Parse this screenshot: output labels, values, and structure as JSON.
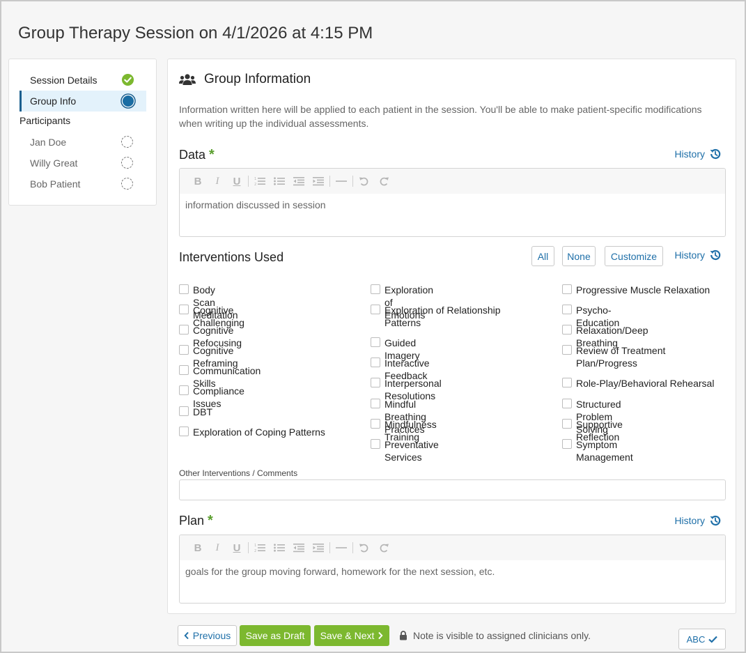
{
  "page": {
    "title": "Group Therapy Session on 4/1/2026 at 4:15 PM"
  },
  "sidebar": {
    "session_details": "Session Details",
    "group_info": "Group Info",
    "participants_heading": "Participants",
    "participants": [
      "Jan Doe",
      "Willy Great",
      "Bob Patient"
    ]
  },
  "group_info": {
    "heading": "Group Information",
    "intro": "Information written here will be applied to each patient in the session. You'll be able to make patient-specific modifications when writing up the individual assessments."
  },
  "data_field": {
    "label": "Data",
    "required_mark": "*",
    "history": "History",
    "value": "information discussed in session"
  },
  "interventions": {
    "label": "Interventions Used",
    "all": "All",
    "none": "None",
    "customize": "Customize",
    "history": "History",
    "columns": [
      [
        "Body Scan Meditation",
        "Cognitive Challenging",
        "Cognitive Refocusing",
        "Cognitive Reframing",
        "Communication Skills",
        "Compliance Issues",
        "DBT",
        "Exploration of Coping Patterns"
      ],
      [
        "Exploration of Emotions",
        "Exploration of Relationship Patterns",
        "Guided Imagery",
        "Interactive Feedback",
        "Interpersonal Resolutions",
        "Mindful Breathing Practices",
        "Mindfulness Training",
        "Preventative Services"
      ],
      [
        "Progressive Muscle Relaxation",
        "Psycho-Education",
        "Relaxation/Deep Breathing",
        "Review of Treatment Plan/Progress",
        "Role-Play/Behavioral Rehearsal",
        "Structured Problem Solving",
        "Supportive Reflection",
        "Symptom Management"
      ]
    ],
    "other_label": "Other Interventions / Comments",
    "other_value": ""
  },
  "plan_field": {
    "label": "Plan",
    "required_mark": "*",
    "history": "History",
    "value": "goals for the group moving forward, homework for the next session, etc."
  },
  "footer": {
    "previous": "Previous",
    "save_draft": "Save as Draft",
    "save_next": "Save & Next",
    "note": "Note is visible to assigned clinicians only.",
    "spellcheck": "ABC"
  },
  "colors": {
    "accent": "#1e6fa8",
    "green": "#7cb82f",
    "active_bg": "#e3f2fb",
    "required": "#5a9e2e"
  }
}
